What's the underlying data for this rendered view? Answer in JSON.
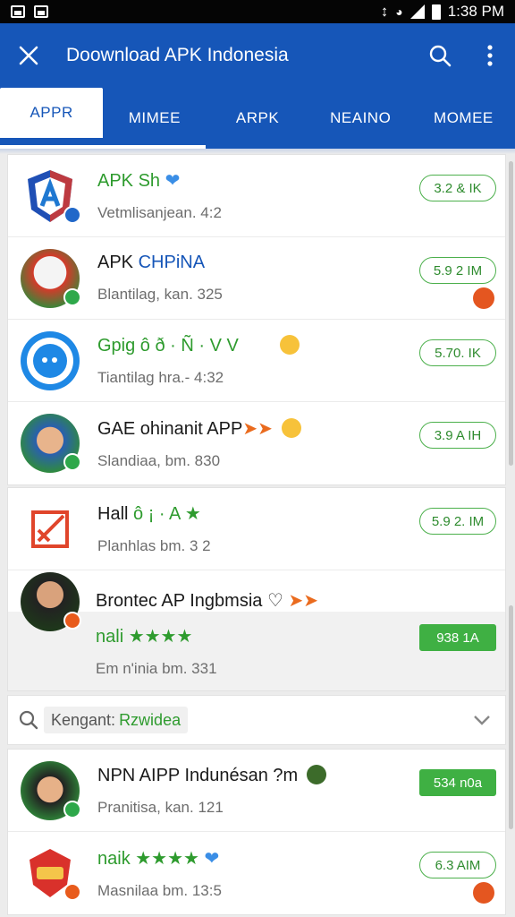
{
  "status_bar": {
    "time": "1:38 PM"
  },
  "app_bar": {
    "title": "Doownload APK Indonesia"
  },
  "tabs": [
    {
      "label": "APPR"
    },
    {
      "label": "MIMEE"
    },
    {
      "label": "ARPK"
    },
    {
      "label": "NEAINO"
    },
    {
      "label": "MOMEE"
    }
  ],
  "apps_group1": [
    {
      "name": "APK Sh",
      "subtitle": "Vetmlisanjean. 4:2",
      "size": "3.2 & IK"
    },
    {
      "name_a": "APK",
      "name_b": "CHPiNA",
      "subtitle": "Blantilag, kan. 325",
      "size": "5.9 2 IM"
    },
    {
      "name": "Gpig ô ð · Ñ · V V",
      "subtitle": "Tiantilag hra.- 4:32",
      "size": "5.70. IK"
    },
    {
      "name": "GAE ohinanit APP",
      "subtitle": "Slandiaa, bm. 830",
      "size": "3.9 A IH"
    }
  ],
  "apps_group2": [
    {
      "name": "Hall",
      "name_suffix": "ô ¡ · A ★",
      "subtitle": "Planhlas bm. 3 2",
      "size": "5.9 2. IM"
    },
    {
      "name": "Brontec AP Ingbmsia",
      "line2": "nali ★★★★",
      "subtitle": "Em n'inia bm. 331",
      "size": "938 1A"
    }
  ],
  "search": {
    "label": "Kengant:",
    "value": "Rzwidea"
  },
  "apps_group3": [
    {
      "name": "NPN AIPP Indunésan ?m",
      "subtitle": "Pranitisa, kan. 121",
      "size": "534 n0a"
    },
    {
      "name": "naik ★★★★",
      "subtitle": "Masnilaa bm. 13:5",
      "size": "6.3 AIM"
    }
  ],
  "colors": {
    "primary": "#1656b8",
    "accent_green": "#3fb043"
  }
}
